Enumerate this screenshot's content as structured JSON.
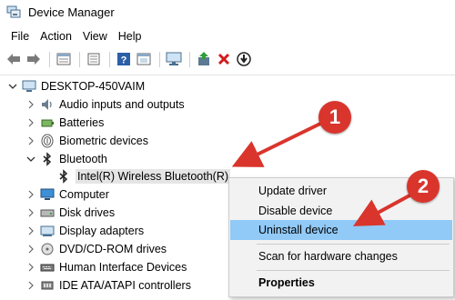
{
  "window": {
    "title": "Device Manager"
  },
  "menubar": {
    "items": [
      "File",
      "Action",
      "View",
      "Help"
    ]
  },
  "toolbar": {
    "buttons": [
      "back-arrow-icon",
      "forward-arrow-icon",
      "properties-sheet-icon",
      "list-view-icon",
      "help-icon",
      "show-hidden-icon",
      "monitor-icon",
      "update-driver-icon",
      "uninstall-x-icon",
      "download-icon"
    ]
  },
  "tree": {
    "root": "DESKTOP-450VAIM",
    "categories": [
      {
        "label": "Audio inputs and outputs",
        "expanded": false
      },
      {
        "label": "Batteries",
        "expanded": false
      },
      {
        "label": "Biometric devices",
        "expanded": false
      },
      {
        "label": "Bluetooth",
        "expanded": true
      },
      {
        "label": "Computer",
        "expanded": false
      },
      {
        "label": "Disk drives",
        "expanded": false
      },
      {
        "label": "Display adapters",
        "expanded": false
      },
      {
        "label": "DVD/CD-ROM drives",
        "expanded": false
      },
      {
        "label": "Human Interface Devices",
        "expanded": false
      },
      {
        "label": "IDE ATA/ATAPI controllers",
        "expanded": false
      }
    ],
    "bluetooth_child": "Intel(R) Wireless Bluetooth(R)"
  },
  "context_menu": {
    "items": [
      "Update driver",
      "Disable device",
      "Uninstall device",
      "Scan for hardware changes",
      "Properties"
    ],
    "highlighted": "Uninstall device"
  },
  "annotations": {
    "badge1": "1",
    "badge2": "2",
    "color": "#d9352d"
  },
  "colors": {
    "highlight": "#91c9f7",
    "menu_bg": "#f2f2f2",
    "selection": "#e5e5e5"
  }
}
